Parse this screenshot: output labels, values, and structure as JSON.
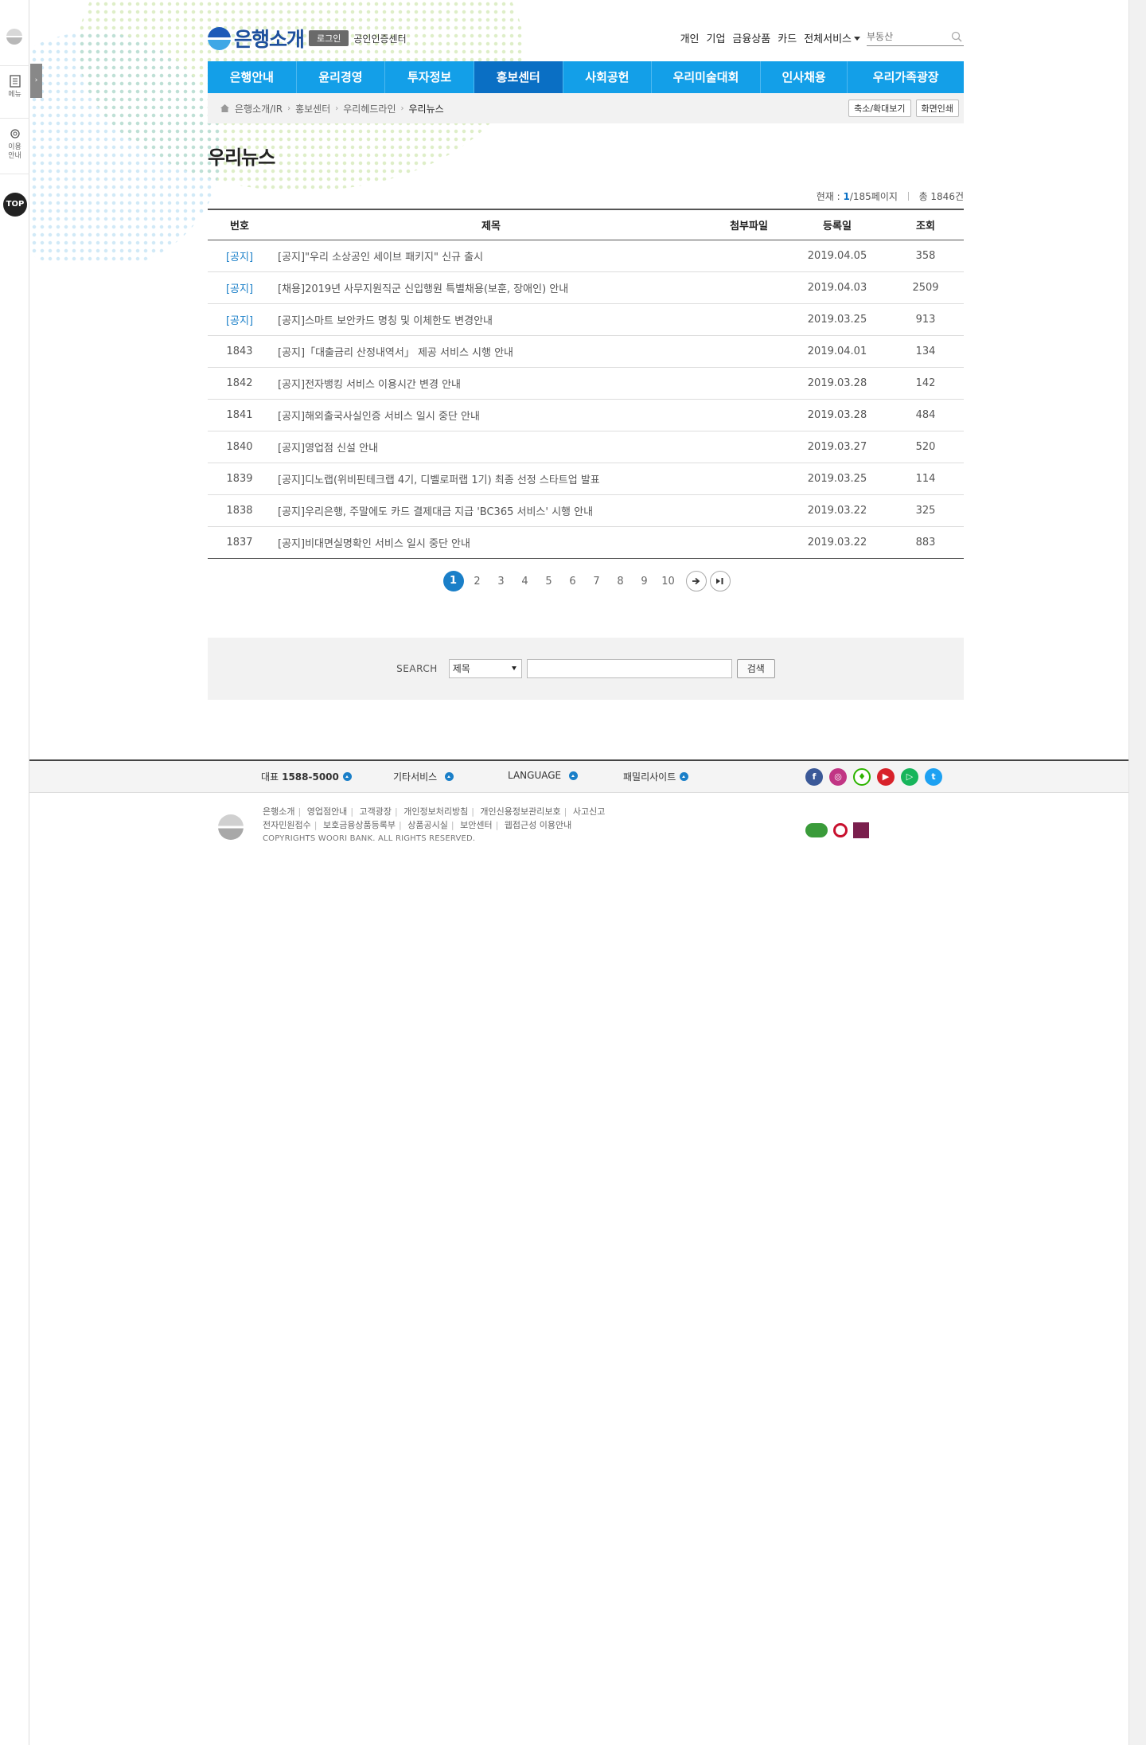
{
  "rail": {
    "menu_label": "메뉴",
    "guide_label_1": "이용",
    "guide_label_2": "안내",
    "top_label": "TOP"
  },
  "header": {
    "brand": "은행소개",
    "login": "로그인",
    "cert_center": "공인인증센터",
    "util_links": [
      "개인",
      "기업",
      "금융상품",
      "카드",
      "전체서비스"
    ],
    "search_placeholder": "부동산"
  },
  "gnb": {
    "tabs": [
      "은행안내",
      "윤리경영",
      "투자정보",
      "홍보센터",
      "사회공헌",
      "우리미술대회",
      "인사채용",
      "우리가족광장"
    ],
    "active": "홍보센터"
  },
  "breadcrumb": {
    "items": [
      "은행소개/IR",
      "홍보센터",
      "우리헤드라인",
      "우리뉴스"
    ],
    "zoom_button": "축소/확대보기",
    "print_button": "화면인쇄"
  },
  "page": {
    "title": "우리뉴스",
    "current_label": "현재 :",
    "current_page": "1",
    "total_pages": "/185페이지",
    "total_label": "총 1846건"
  },
  "table": {
    "headers": [
      "번호",
      "제목",
      "첨부파일",
      "등록일",
      "조회"
    ],
    "rows": [
      {
        "num": "[공지]",
        "title": "[공지]\"우리 소상공인 세이브 패키지\" 신규 출시",
        "attach": "",
        "date": "2019.04.05",
        "views": "358",
        "notice": true
      },
      {
        "num": "[공지]",
        "title": "[채용]2019년 사무지원직군 신입행원 특별채용(보훈, 장애인) 안내",
        "attach": "",
        "date": "2019.04.03",
        "views": "2509",
        "notice": true
      },
      {
        "num": "[공지]",
        "title": "[공지]스마트 보안카드 명칭 및 이체한도 변경안내",
        "attach": "",
        "date": "2019.03.25",
        "views": "913",
        "notice": true
      },
      {
        "num": "1843",
        "title": "[공지]「대출금리 산정내역서」 제공 서비스 시행 안내",
        "attach": "",
        "date": "2019.04.01",
        "views": "134",
        "notice": false
      },
      {
        "num": "1842",
        "title": "[공지]전자뱅킹 서비스 이용시간 변경 안내",
        "attach": "",
        "date": "2019.03.28",
        "views": "142",
        "notice": false
      },
      {
        "num": "1841",
        "title": "[공지]해외출국사실인증 서비스 일시 중단 안내",
        "attach": "",
        "date": "2019.03.28",
        "views": "484",
        "notice": false
      },
      {
        "num": "1840",
        "title": "[공지]영업점 신설 안내",
        "attach": "",
        "date": "2019.03.27",
        "views": "520",
        "notice": false
      },
      {
        "num": "1839",
        "title": "[공지]디노랩(위비핀테크랩 4기, 디벨로퍼랩 1기) 최종 선정 스타트업 발표",
        "attach": "",
        "date": "2019.03.25",
        "views": "114",
        "notice": false
      },
      {
        "num": "1838",
        "title": "[공지]우리은행, 주말에도 카드 결제대금 지급 'BC365 서비스' 시행 안내",
        "attach": "",
        "date": "2019.03.22",
        "views": "325",
        "notice": false
      },
      {
        "num": "1837",
        "title": "[공지]비대면실명확인 서비스 일시 중단 안내",
        "attach": "",
        "date": "2019.03.22",
        "views": "883",
        "notice": false
      }
    ]
  },
  "pager": {
    "pages": [
      "1",
      "2",
      "3",
      "4",
      "5",
      "6",
      "7",
      "8",
      "9",
      "10"
    ],
    "current": "1"
  },
  "search": {
    "label": "SEARCH",
    "select_value": "제목",
    "button": "검색"
  },
  "footer": {
    "rep_label": "대표",
    "rep_number": "1588-5000",
    "other_services": "기타서비스",
    "language": "LANGUAGE",
    "family_sites": "패밀리사이트",
    "links_row1": [
      "은행소개",
      "영업점안내",
      "고객광장",
      "개인정보처리방침",
      "개인신용정보관리보호",
      "사고신고"
    ],
    "links_row2": [
      "전자민원접수",
      "보호금융상품등록부",
      "상품공시실",
      "보안센터",
      "웹접근성 이용안내"
    ],
    "copyright": "COPYRIGHTS WOORI BANK. ALL RIGHTS RESERVED.",
    "social": [
      "facebook",
      "instagram",
      "kakao",
      "youtube",
      "play",
      "twitter"
    ]
  },
  "colors": {
    "gnb_blue": "#139fe8",
    "gnb_active": "#0a6fc4",
    "accent_blue": "#1a7fc8"
  }
}
